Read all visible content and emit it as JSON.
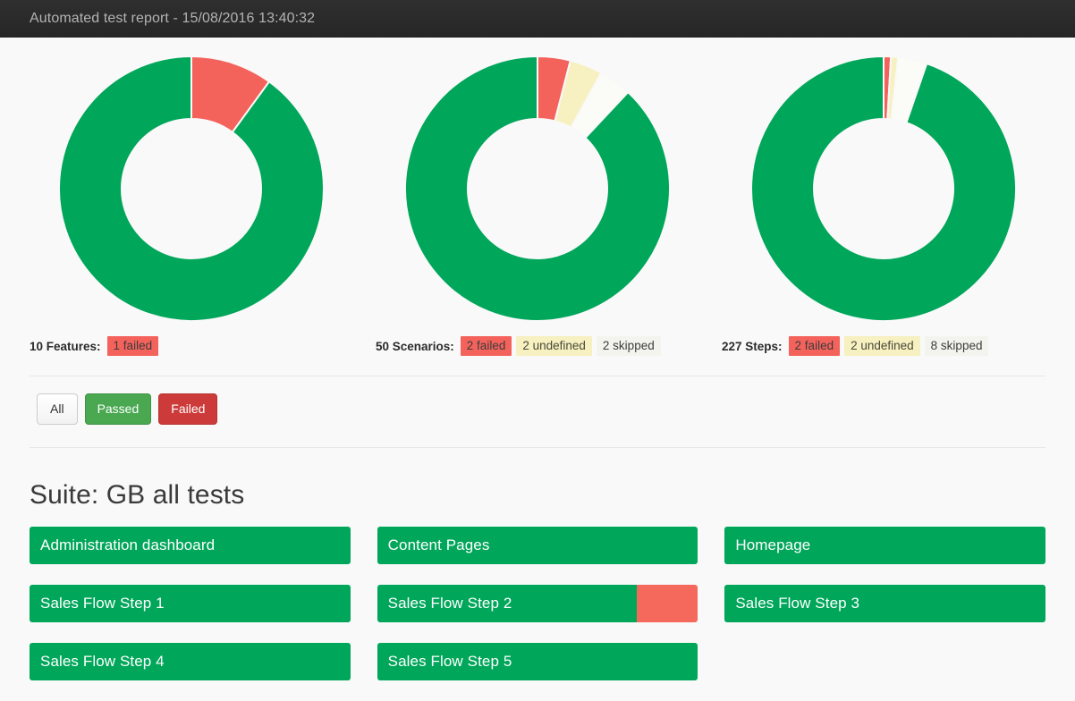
{
  "header": {
    "title": "Automated test report - 15/08/2016 13:40:32"
  },
  "colors": {
    "passed": "#00a65a",
    "failed": "#f4625c",
    "undefined": "#f7f0c0",
    "skipped": "#fbfbf8",
    "header_bg": "#2b2b2b",
    "page_bg": "#f9f9f9"
  },
  "charts": [
    {
      "name": "features-donut",
      "total_label": "10 Features:",
      "badges": [
        {
          "label": "1 failed",
          "kind": "failed"
        }
      ],
      "chart_data": {
        "type": "pie",
        "title": "10 Features",
        "categories": [
          "passed",
          "failed"
        ],
        "values": [
          9,
          1
        ],
        "colors": [
          "#00a65a",
          "#f4625c"
        ],
        "donut": true,
        "legend": "below"
      }
    },
    {
      "name": "scenarios-donut",
      "total_label": "50 Scenarios:",
      "badges": [
        {
          "label": "2 failed",
          "kind": "failed"
        },
        {
          "label": "2 undefined",
          "kind": "undefined"
        },
        {
          "label": "2 skipped",
          "kind": "skipped"
        }
      ],
      "chart_data": {
        "type": "pie",
        "title": "50 Scenarios",
        "categories": [
          "passed",
          "failed",
          "undefined",
          "skipped"
        ],
        "values": [
          44,
          2,
          2,
          2
        ],
        "colors": [
          "#00a65a",
          "#f4625c",
          "#f7f0c0",
          "#fbfbf8"
        ],
        "donut": true,
        "legend": "below"
      }
    },
    {
      "name": "steps-donut",
      "total_label": "227 Steps:",
      "badges": [
        {
          "label": "2 failed",
          "kind": "failed"
        },
        {
          "label": "2 undefined",
          "kind": "undefined"
        },
        {
          "label": "8 skipped",
          "kind": "skipped"
        }
      ],
      "chart_data": {
        "type": "pie",
        "title": "227 Steps",
        "categories": [
          "passed",
          "failed",
          "undefined",
          "skipped"
        ],
        "values": [
          215,
          2,
          2,
          8
        ],
        "colors": [
          "#00a65a",
          "#f4625c",
          "#f7f0c0",
          "#fbfbf8"
        ],
        "donut": true,
        "legend": "below"
      }
    }
  ],
  "filters": [
    {
      "label": "All",
      "style": "all"
    },
    {
      "label": "Passed",
      "style": "passed"
    },
    {
      "label": "Failed",
      "style": "failed"
    }
  ],
  "suite": {
    "title": "Suite: GB all tests",
    "columns": [
      {
        "features": [
          {
            "name": "Administration dashboard",
            "passed_pct": 100,
            "failed_pct": 0
          },
          {
            "name": "Sales Flow Step 1",
            "passed_pct": 100,
            "failed_pct": 0
          },
          {
            "name": "Sales Flow Step 4",
            "passed_pct": 100,
            "failed_pct": 0
          }
        ]
      },
      {
        "features": [
          {
            "name": "Content Pages",
            "passed_pct": 100,
            "failed_pct": 0
          },
          {
            "name": "Sales Flow Step 2",
            "passed_pct": 81,
            "failed_pct": 19
          },
          {
            "name": "Sales Flow Step 5",
            "passed_pct": 100,
            "failed_pct": 0
          }
        ]
      },
      {
        "features": [
          {
            "name": "Homepage",
            "passed_pct": 100,
            "failed_pct": 0
          },
          {
            "name": "Sales Flow Step 3",
            "passed_pct": 100,
            "failed_pct": 0
          }
        ]
      }
    ]
  }
}
